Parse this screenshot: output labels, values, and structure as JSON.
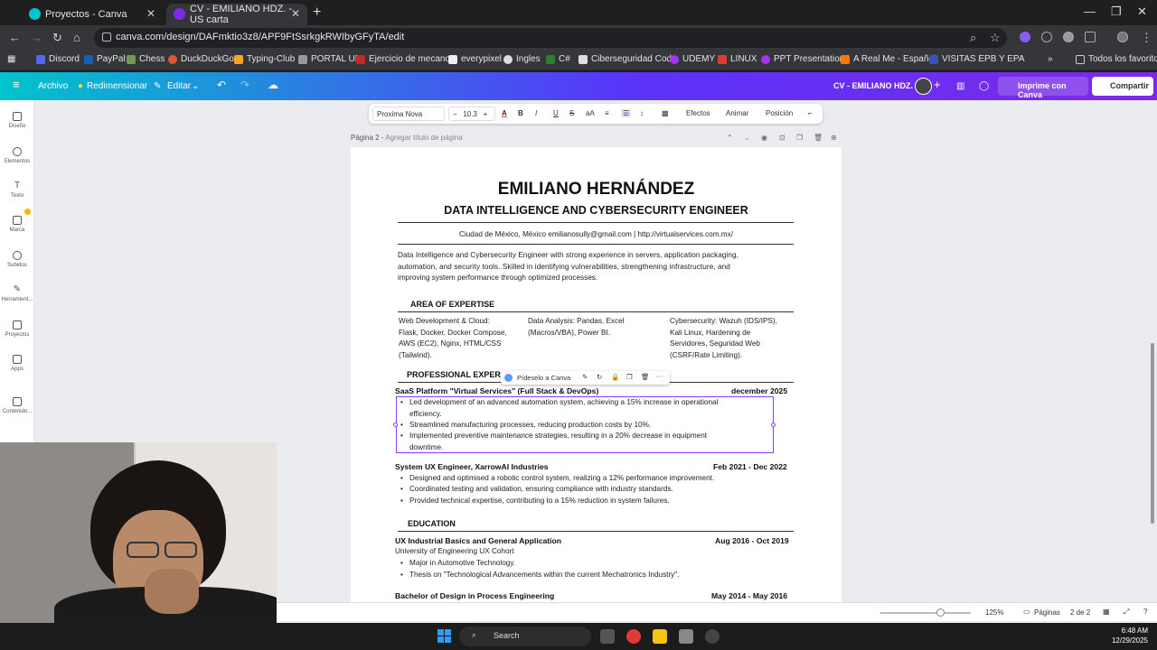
{
  "browser": {
    "tabs": [
      {
        "label": "Proyectos - Canva"
      },
      {
        "label": "CV - EMILIANO HDZ. - US carta"
      }
    ],
    "url": "canva.com/design/DAFmktio3z8/APF9FtSsrkgkRWIbyGFyTA/edit",
    "bookmarks": [
      "Discord",
      "PayPal",
      "Chess",
      "DuckDuckGo",
      "Typing-Club",
      "PORTAL UP",
      "Ejercicio de mecano...",
      "everypixel",
      "Ingles",
      "C#",
      "Ciberseguridad Cod...",
      "UDEMY",
      "LINUX",
      "PPT Presentations",
      "A Real Me - Español",
      "VISITAS EPB Y EPA"
    ],
    "bookmarks_right": "Todos los favoritos"
  },
  "canva": {
    "menu": {
      "archivo": "Archivo",
      "redimensionar": "Redimensionar",
      "editar": "Editar"
    },
    "doc_title": "CV - EMILIANO HDZ.",
    "print_label": "Imprime con Canva",
    "share_label": "Compartir",
    "sidebar": [
      {
        "label": "Diseño"
      },
      {
        "label": "Elementos"
      },
      {
        "label": "Texto"
      },
      {
        "label": "Marca"
      },
      {
        "label": "Subidos"
      },
      {
        "label": "Herramient..."
      },
      {
        "label": "Proyectos"
      },
      {
        "label": "Apps"
      },
      {
        "label": "Contenido..."
      }
    ],
    "toolbar": {
      "font": "Proxima Nova",
      "size": "10.3",
      "minus": "−",
      "plus": "+",
      "effects": "Efectos",
      "animate": "Animar",
      "position": "Posición"
    },
    "page_label": "Página 2",
    "page_title_placeholder": "Agregar título de página",
    "float_label": "Pídeselo a Canva",
    "status": {
      "zoom": "125%",
      "pages_label": "Páginas",
      "page_count": "2 de 2"
    }
  },
  "cv": {
    "name": "EMILIANO HERNÁNDEZ",
    "title": "DATA INTELLIGENCE AND CYBERSECURITY ENGINEER",
    "contact": "Ciudad de México, México  emilianosully@gmail.com  |   http://virtualservices.com.mx/",
    "summary_lines": [
      "Data Intelligence and Cybersecurity Engineer with strong experience in servers, application packaging,",
      "automation, and security tools. Skilled in identifying vulnerabilities, strengthening infrastructure, and",
      "improving system performance through optimized processes."
    ],
    "expertise_heading": "AREA OF EXPERTISE",
    "expertise": [
      [
        "Web Development & Cloud:",
        "Flask, Docker, Docker Compose,",
        "AWS (EC2), Nginx, HTML/CSS",
        "(Tailwind)."
      ],
      [
        "Data Analysis: Pandas, Excel",
        "(Macros/VBA), Power BI."
      ],
      [
        "Cybersecurity: Wazuh (IDS/IPS),",
        "Kali Linux, Hardening de",
        "Servidores, Seguridad Web",
        "(CSRF/Rate Limiting)."
      ]
    ],
    "experience_heading": "PROFESSIONAL EXPER",
    "jobs": [
      {
        "title": "SaaS Platform \"Virtual Services\" (Full Stack & DevOps)",
        "date": "december 2025",
        "bullets": [
          [
            "Led development of an advanced automation system, achieving a 15% increase in operational",
            "efficiency."
          ],
          [
            "Streamlined manufacturing processes, reducing production costs by 10%."
          ],
          [
            "Implemented preventive maintenance strategies, resulting in a 20% decrease in equipment",
            "downtime."
          ]
        ]
      },
      {
        "title": "System UX Engineer, XarrowAI Industries",
        "date": "Feb 2021 - Dec 2022",
        "bullets": [
          [
            "Designed and optimised a robotic control system, realizing a 12% performance improvement."
          ],
          [
            "Coordinated testing and validation, ensuring compliance with industry standards."
          ],
          [
            "Provided technical expertise, contributing to a 15% reduction in system failures."
          ]
        ]
      }
    ],
    "education_heading": "EDUCATION",
    "education": [
      {
        "title": "UX Industrial Basics and General Application",
        "date": "Aug 2016 - Oct 2019",
        "school": "University of Engineering UX Cohort",
        "bullets": [
          "Major in Automotive Technology.",
          "Thesis on \"Technological Advancements within the current Mechatronics Industry\"."
        ]
      },
      {
        "title": "Bachelor of Design in Process Engineering",
        "date": "May 2014 - May 2016"
      }
    ]
  },
  "taskbar": {
    "search": "Search",
    "time": "6:48 AM",
    "date": "12/29/2025"
  }
}
